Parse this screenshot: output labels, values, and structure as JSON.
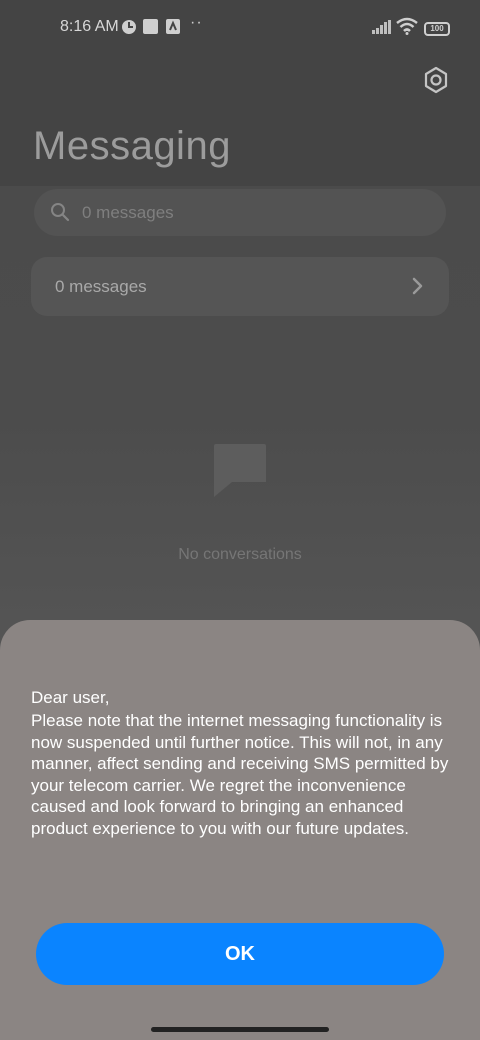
{
  "status_bar": {
    "time": "8:16 AM",
    "battery": "100",
    "icons": [
      "notification-icon",
      "square-icon",
      "app-icon",
      "more-dots-icon",
      "signal-icon",
      "wifi-icon",
      "battery-icon"
    ]
  },
  "header": {
    "title": "Messaging",
    "settings_icon": "settings-icon"
  },
  "search": {
    "placeholder": "0 messages"
  },
  "messages_card": {
    "label": "0 messages"
  },
  "empty_state": {
    "text": "No conversations"
  },
  "dialog": {
    "greeting": "Dear user,",
    "body": "Please note that the internet messaging functionality is now suspended until further notice. This will not, in any manner, affect sending and receiving SMS permitted by your telecom carrier. We regret the inconvenience caused and look forward to bringing an enhanced product experience to you with our future updates.",
    "ok_label": "OK"
  },
  "colors": {
    "accent": "#0a84ff",
    "dialog_bg": "#8b8583"
  }
}
